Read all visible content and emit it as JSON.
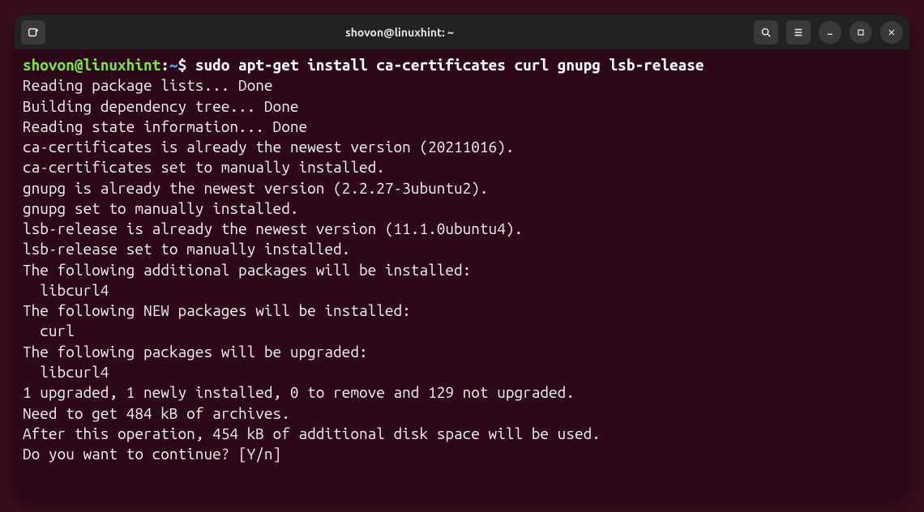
{
  "titlebar": {
    "title": "shovon@linuxhint: ~"
  },
  "prompt": {
    "user_host": "shovon@linuxhint",
    "colon": ":",
    "path": "~",
    "dollar": "$"
  },
  "command": "sudo apt-get install ca-certificates curl gnupg lsb-release",
  "output_lines": [
    "Reading package lists... Done",
    "Building dependency tree... Done",
    "Reading state information... Done",
    "ca-certificates is already the newest version (20211016).",
    "ca-certificates set to manually installed.",
    "gnupg is already the newest version (2.2.27-3ubuntu2).",
    "gnupg set to manually installed.",
    "lsb-release is already the newest version (11.1.0ubuntu4).",
    "lsb-release set to manually installed.",
    "The following additional packages will be installed:",
    "  libcurl4",
    "The following NEW packages will be installed:",
    "  curl",
    "The following packages will be upgraded:",
    "  libcurl4",
    "1 upgraded, 1 newly installed, 0 to remove and 129 not upgraded.",
    "Need to get 484 kB of archives.",
    "After this operation, 454 kB of additional disk space will be used.",
    "Do you want to continue? [Y/n]"
  ]
}
